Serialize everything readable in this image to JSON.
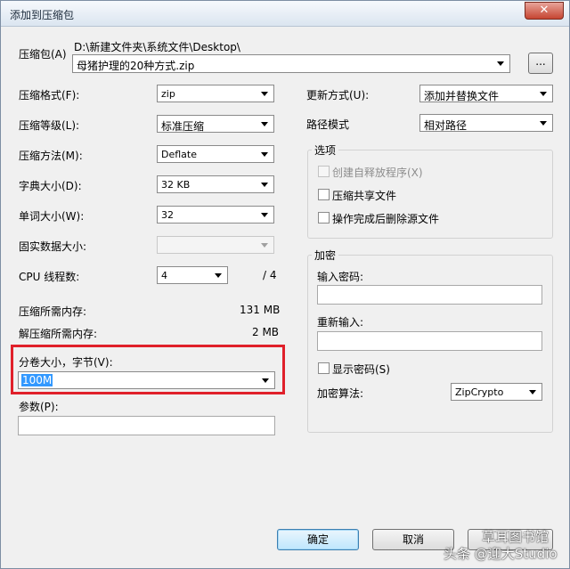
{
  "window": {
    "title": "添加到压缩包",
    "close_glyph": "✕"
  },
  "archive": {
    "label": "压缩包(A)",
    "path": "D:\\新建文件夹\\系统文件\\Desktop\\",
    "filename": "母猪护理的20种方式.zip",
    "browse_label": "..."
  },
  "left": {
    "format": {
      "label": "压缩格式(F):",
      "value": "zip"
    },
    "level": {
      "label": "压缩等级(L):",
      "value": "标准压缩"
    },
    "method": {
      "label": "压缩方法(M):",
      "value": "Deflate"
    },
    "dict": {
      "label": "字典大小(D):",
      "value": "32 KB"
    },
    "word": {
      "label": "单词大小(W):",
      "value": "32"
    },
    "solid": {
      "label": "固实数据大小:",
      "value": ""
    },
    "cpu": {
      "label": "CPU 线程数:",
      "value": "4",
      "max": "/ 4"
    },
    "mem_compress": {
      "label": "压缩所需内存:",
      "value": "131 MB"
    },
    "mem_decompress": {
      "label": "解压缩所需内存:",
      "value": "2 MB"
    },
    "volume": {
      "label": "分卷大小，字节(V):",
      "value": "100M"
    },
    "params": {
      "label": "参数(P):",
      "value": ""
    }
  },
  "right": {
    "update": {
      "label": "更新方式(U):",
      "value": "添加并替换文件"
    },
    "pathmode": {
      "label": "路径模式",
      "value": "相对路径"
    },
    "options": {
      "title": "选项",
      "sfx": "创建自释放程序(X)",
      "shared": "压缩共享文件",
      "delete_after": "操作完成后删除源文件"
    },
    "encrypt": {
      "title": "加密",
      "password_label": "输入密码:",
      "reenter_label": "重新输入:",
      "show_password": "显示密码(S)",
      "method_label": "加密算法:",
      "method_value": "ZipCrypto"
    }
  },
  "buttons": {
    "ok": "确定",
    "cancel": "取消"
  },
  "watermark": {
    "line1": "头条 @迎大Studio",
    "line2": "草耳图书馆"
  }
}
